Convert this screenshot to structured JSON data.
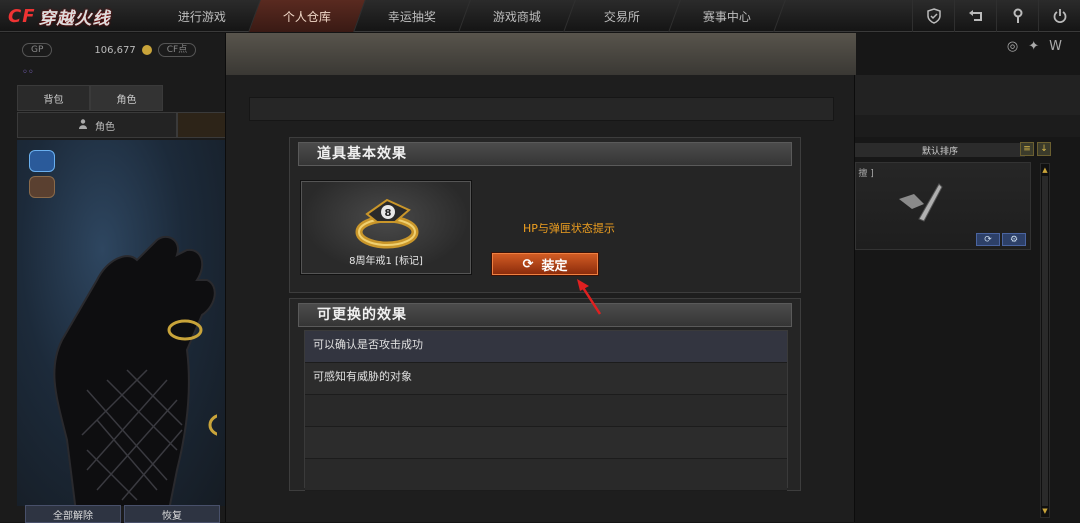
{
  "app": {
    "logo_cf": "CF",
    "logo_text": "穿越火线"
  },
  "nav": [
    "进行游戏",
    "个人仓库",
    "幸运抽奖",
    "游戏商城",
    "交易所",
    "赛事中心"
  ],
  "top_icons": [
    "shield-icon",
    "back-icon",
    "wrench-icon",
    "power-icon"
  ],
  "sidebar": {
    "gp_label": "GP",
    "gp_value": "106,677",
    "cf_label": "CF点",
    "tabs": [
      "背包",
      "角色"
    ],
    "subtab": "角色",
    "bottom_buttons": [
      "全部解除",
      "恢复"
    ]
  },
  "right": {
    "sort_label": "默认排序",
    "card_tag": "[ 擅 ]"
  },
  "dialog": {
    "section1_title": "道具基本效果",
    "item_name": "8周年戒1 [标记]",
    "hint": "HP与弹匣状态提示",
    "equip_label": "装定",
    "section2_title": "可更换的效果",
    "effects": [
      "可以确认是否攻击成功",
      "可感知有威胁的对象",
      "",
      "",
      ""
    ]
  }
}
